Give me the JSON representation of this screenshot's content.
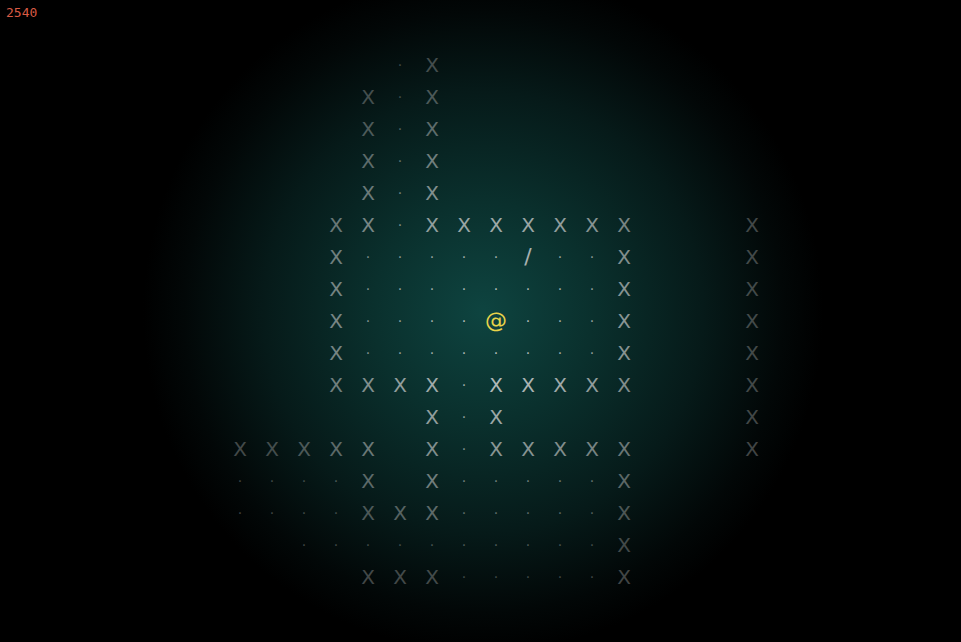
{
  "hud": {
    "score": "2540"
  },
  "map": {
    "rows": [
      "     ·X          ",
      "    X·X          ",
      "    X·X          ",
      "    X·X          ",
      "    X·X          ",
      "   XX·XXXXXXX   X",
      "   X·····/··X   X",
      "   X········X   X",
      "   X····@···X   X",
      "   X········X   X",
      "   XXXX·XXXXX   X",
      "      X·X       X",
      "XXXXX X·XXXXX   X",
      "····X X·····X    ",
      "····XXX·····X    ",
      "  ··········X    ",
      "    XXX·····X    "
    ]
  }
}
